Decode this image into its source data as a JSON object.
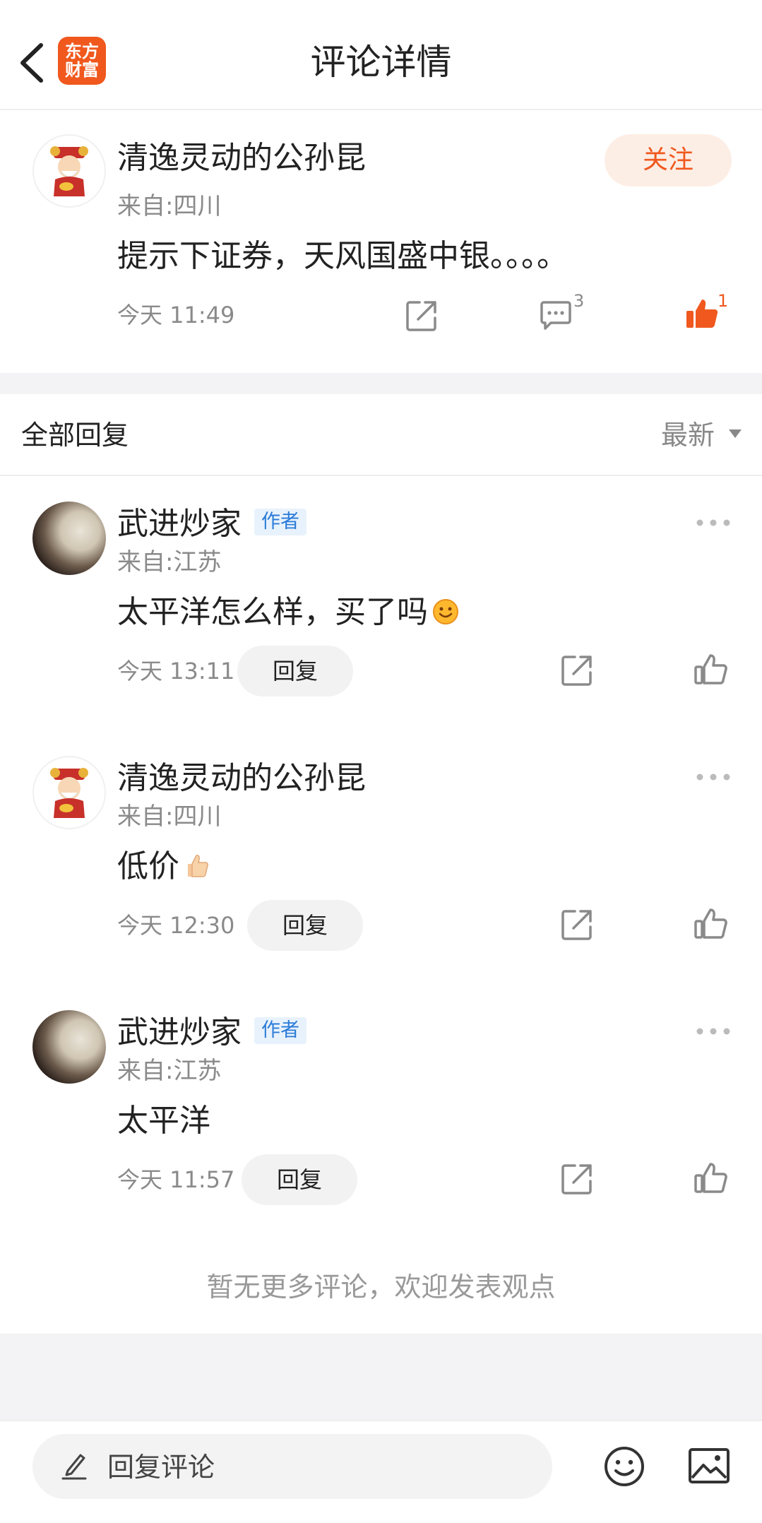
{
  "header": {
    "title": "评论详情",
    "logo_line1": "东方",
    "logo_line2": "财富"
  },
  "main_comment": {
    "username": "清逸灵动的公孙昆",
    "location": "来自:四川",
    "text": "提示下证券，天风国盛中银。。。。",
    "time": "今天 11:49",
    "comment_count": "3",
    "like_count": "1",
    "follow_label": "关注"
  },
  "replies_section": {
    "title": "全部回复",
    "sort_label": "最新"
  },
  "replies": [
    {
      "username": "武进炒家",
      "author_tag": "作者",
      "location": "来自:江苏",
      "text": "太平洋怎么样，买了吗",
      "time": "今天 13:11",
      "reply_label": "回复"
    },
    {
      "username": "清逸灵动的公孙昆",
      "location": "来自:四川",
      "text": "低价",
      "time": "今天 12:30",
      "reply_label": "回复"
    },
    {
      "username": "武进炒家",
      "author_tag": "作者",
      "location": "来自:江苏",
      "text": "太平洋",
      "time": "今天 11:57",
      "reply_label": "回复"
    }
  ],
  "footer": {
    "no_more_text": "暂无更多评论，欢迎发表观点",
    "reply_placeholder": "回复评论"
  },
  "colors": {
    "brand": "#f0581e",
    "author_tag": "#2a7bd8",
    "muted_text": "#8a8a8a"
  }
}
